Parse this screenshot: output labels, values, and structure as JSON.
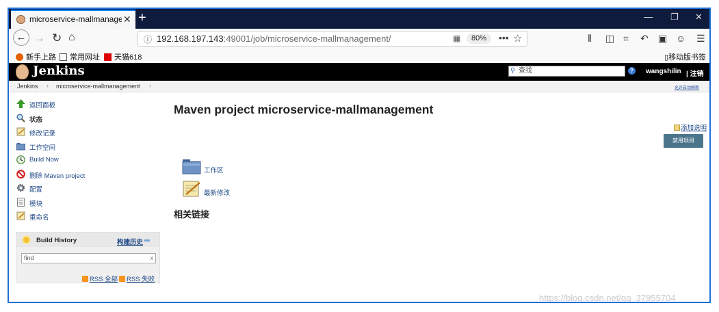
{
  "browser": {
    "tab_title": "microservice-mallmanageme",
    "new_tab": "+",
    "window_controls": {
      "minimize": "—",
      "restore": "❐",
      "close": "✕"
    },
    "url_host": "192.168.197.143",
    "url_rest": ":49001/job/microservice-mallmanagement/",
    "zoom": "80%",
    "bookmarks": [
      "新手上路",
      "常用网址",
      "天猫618"
    ],
    "mobile_bookmarks": "移动版书签"
  },
  "jenkins": {
    "logo_text": "Jenkins",
    "search_placeholder": "查找",
    "user": "wangshilin",
    "logout": "| 注销",
    "breadcrumb": [
      "Jenkins",
      "microservice-mallmanagement"
    ],
    "auto_refresh": "允许自动刷新"
  },
  "sidebar": {
    "tasks": [
      {
        "label": "返回面板",
        "icon": "up-arrow-icon"
      },
      {
        "label": "状态",
        "icon": "search-icon"
      },
      {
        "label": "修改记录",
        "icon": "notepad-icon"
      },
      {
        "label": "工作空间",
        "icon": "folder-icon"
      },
      {
        "label": "Build Now",
        "icon": "clock-icon"
      },
      {
        "label": "删除 Maven project",
        "icon": "no-icon"
      },
      {
        "label": "配置",
        "icon": "gear-icon"
      },
      {
        "label": "模块",
        "icon": "document-icon"
      },
      {
        "label": "重命名",
        "icon": "notepad-icon"
      }
    ],
    "build_history": {
      "title": "Build History",
      "trend": "构建历史",
      "find_placeholder": "find",
      "clear": "x",
      "rss_all": "RSS 全部",
      "rss_failed": "RSS 失败"
    }
  },
  "main": {
    "title": "Maven project microservice-mallmanagement",
    "add_description": "添加说明",
    "disable_button": "禁用项目",
    "links": [
      {
        "label": "工作区",
        "icon": "folder-icon"
      },
      {
        "label": "最新修改",
        "icon": "notepad-icon"
      }
    ],
    "related": "相关链接"
  },
  "watermark": "https://blog.csdn.net/qq_37955704"
}
